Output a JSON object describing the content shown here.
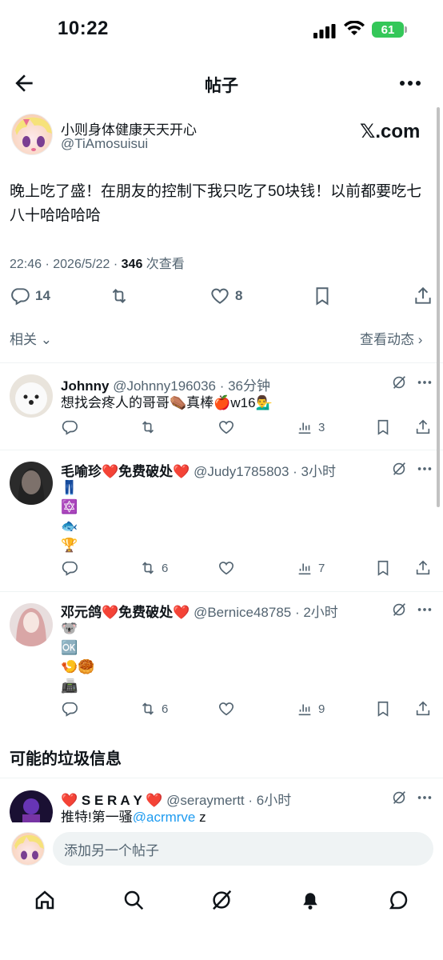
{
  "status_bar": {
    "time": "10:22",
    "battery": "61"
  },
  "header": {
    "title": "帖子"
  },
  "post": {
    "author_name": "小则身体健康天天开心",
    "author_handle": "@TiAmosuisui",
    "source": "𝕏.com",
    "text": "晚上吃了盛！在朋友的控制下我只吃了50块钱！以前都要吃七八十哈哈哈哈",
    "timestamp": "22:46 · 2026/5/22 · ",
    "views_count": "346",
    "views_label": " 次查看",
    "replies": "14",
    "retweets": "",
    "likes": "8",
    "related_label": "相关",
    "view_activity_label": "查看动态"
  },
  "replies": [
    {
      "name": "Johnny",
      "handle": "@Johnny196036 · 36分钟",
      "lines": [
        "想找会疼人的哥哥⚰️真棒🍎w16💁‍♂️"
      ],
      "retweets": "",
      "views": "3"
    },
    {
      "name": "毛喻珍❤️免费破处❤️",
      "handle": "@Judy1785803 · 3小时",
      "lines": [
        "👖",
        "🔯",
        "🐟",
        "🏆"
      ],
      "retweets": "6",
      "views": "7"
    },
    {
      "name": "邓元鸽❤️免费破处❤️",
      "handle": "@Bernice48785 · 2小时",
      "lines": [
        "🐨",
        "🆗",
        "🍤🥮",
        "📠"
      ],
      "retweets": "6",
      "views": "9"
    }
  ],
  "spam_section": {
    "title": "可能的垃圾信息",
    "item": {
      "name": "❤️ S E R A Y ❤️",
      "handle": "@seraymertt · 6小时",
      "text_prefix": "推特!第一骚",
      "mention": "@acrmrve",
      "text_suffix": " z"
    }
  },
  "composer": {
    "placeholder": "添加另一个帖子"
  },
  "tabs": [
    "home-icon",
    "search-icon",
    "grok-icon",
    "notifications-icon",
    "messages-icon"
  ],
  "colors": {
    "accent": "#1d9bf0",
    "secondary_text": "#536471",
    "battery": "#34c759"
  }
}
